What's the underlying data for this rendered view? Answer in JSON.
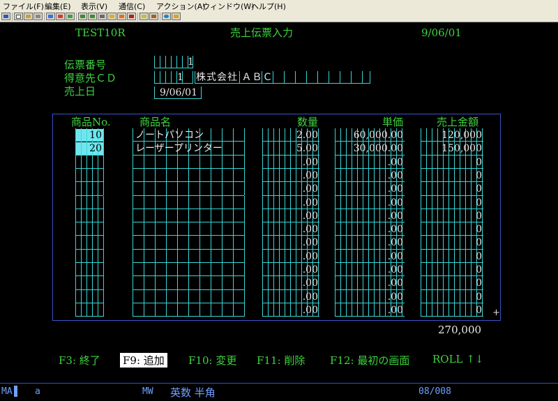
{
  "menu": [
    "ファイル(F)",
    "編集(E)",
    "表示(V)",
    "通信(C)",
    "アクション(A)",
    "ウィンドウ(W)",
    "ヘルプ(H)"
  ],
  "screen": {
    "program_id": "TEST10R",
    "title": "売上伝票入力",
    "date": "9/06/01"
  },
  "header_form": {
    "slip_label": "伝票番号",
    "slip_value": "1",
    "customer_label": "得意先ＣＤ",
    "customer_code": "1",
    "customer_name": "株式会社 ＡＢＣ",
    "sales_date_label": "売上日",
    "sales_date_value": "9/06/01"
  },
  "table": {
    "columns": [
      "商品No.",
      "商品名",
      "数量",
      "単価",
      "売上金額"
    ],
    "rows": [
      {
        "no": "10",
        "name": "ノートパソコン",
        "qty": "2.00",
        "price": "60,000.00",
        "amount": "120,000"
      },
      {
        "no": "20",
        "name": "レーザープリンター",
        "qty": "5.00",
        "price": "30,000.00",
        "amount": "150,000"
      },
      {
        "no": "",
        "name": "",
        "qty": ".00",
        "price": ".00",
        "amount": "0"
      },
      {
        "no": "",
        "name": "",
        "qty": ".00",
        "price": ".00",
        "amount": "0"
      },
      {
        "no": "",
        "name": "",
        "qty": ".00",
        "price": ".00",
        "amount": "0"
      },
      {
        "no": "",
        "name": "",
        "qty": ".00",
        "price": ".00",
        "amount": "0"
      },
      {
        "no": "",
        "name": "",
        "qty": ".00",
        "price": ".00",
        "amount": "0"
      },
      {
        "no": "",
        "name": "",
        "qty": ".00",
        "price": ".00",
        "amount": "0"
      },
      {
        "no": "",
        "name": "",
        "qty": ".00",
        "price": ".00",
        "amount": "0"
      },
      {
        "no": "",
        "name": "",
        "qty": ".00",
        "price": ".00",
        "amount": "0"
      },
      {
        "no": "",
        "name": "",
        "qty": ".00",
        "price": ".00",
        "amount": "0"
      },
      {
        "no": "",
        "name": "",
        "qty": ".00",
        "price": ".00",
        "amount": "0"
      },
      {
        "no": "",
        "name": "",
        "qty": ".00",
        "price": ".00",
        "amount": "0"
      },
      {
        "no": "",
        "name": "",
        "qty": ".00",
        "price": ".00",
        "amount": "0"
      }
    ],
    "more_marker": "+",
    "total": "270,000"
  },
  "function_keys": [
    {
      "label": "F3: 終了",
      "selected": false
    },
    {
      "label": "F9: 追加",
      "selected": true
    },
    {
      "label": "F10: 変更",
      "selected": false
    },
    {
      "label": "F11: 削除",
      "selected": false
    },
    {
      "label": "F12: 最初の画面",
      "selected": false
    },
    {
      "label": "ROLL ↑↓",
      "selected": false
    }
  ],
  "status": {
    "mode": "MA",
    "field": "a",
    "mw": "MW",
    "ime": "英数 半角",
    "position": "08/008"
  },
  "colors": {
    "field_text": "#3ed43e",
    "input_lines": "#39d7d7",
    "grid_border": "#3a55c9",
    "highlight": "#6fe6ee",
    "status_text": "#6fa0ff"
  }
}
